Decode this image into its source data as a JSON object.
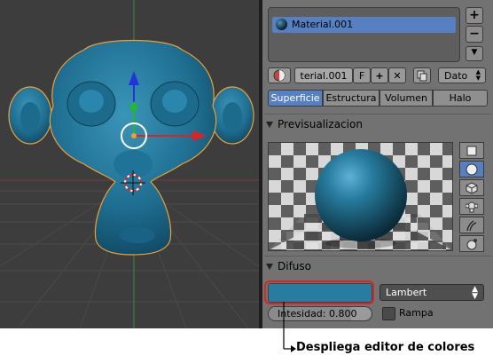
{
  "material_slots": {
    "items": [
      {
        "label": "Material.001",
        "selected": true
      }
    ],
    "add_icon": "plus-icon",
    "remove_icon": "minus-icon",
    "expand_icon": "down-triangle-icon"
  },
  "datablock": {
    "name": "terial.001",
    "fake_user": "F",
    "link_mode": "Dato"
  },
  "tabs": [
    {
      "label": "Superficie",
      "active": true
    },
    {
      "label": "Estructura",
      "active": false
    },
    {
      "label": "Volumen",
      "active": false
    },
    {
      "label": "Halo",
      "active": false
    }
  ],
  "preview": {
    "header": "Previsualizacion",
    "selected_shape": "sphere",
    "shapes": [
      "plane-icon",
      "sphere-icon",
      "cube-icon",
      "monkey-icon",
      "hair-icon",
      "sky-icon"
    ]
  },
  "diffuse": {
    "header": "Difuso",
    "color": "#277c9f",
    "shader": "Lambert",
    "intensity_label": "Intesidad: 0.800",
    "intensity_value": 0.8,
    "ramp_label": "Rampa",
    "ramp_checked": false
  },
  "annotation": {
    "caption": "Despliega editor de colores",
    "highlight_color": "#e02222"
  },
  "colors": {
    "viewport_bg": "#3d3d3d",
    "panel_bg": "#727272",
    "accent_selected": "#5680c2",
    "object_color": "#277c9f",
    "selection_outline": "#f0a030"
  }
}
